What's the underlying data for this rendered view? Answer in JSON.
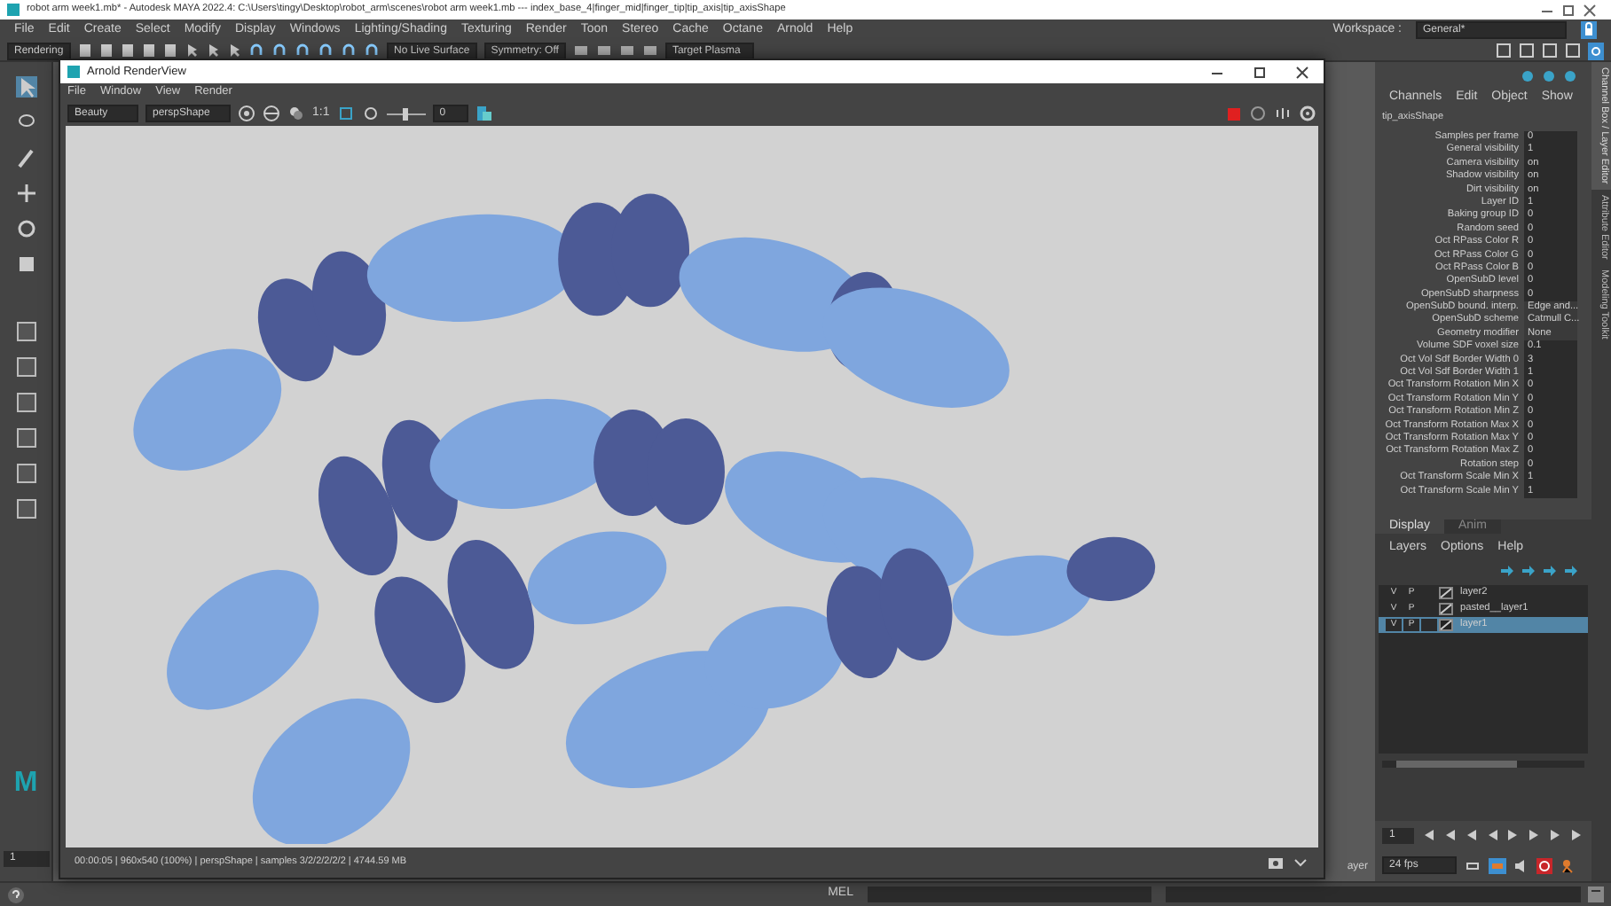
{
  "app_window": {
    "logo": "M",
    "title": "robot arm week1.mb* - Autodesk MAYA 2022.4: C:\\Users\\tingy\\Desktop\\robot_arm\\scenes\\robot arm week1.mb  ---  index_base_4|finger_mid|finger_tip|tip_axis|tip_axisShape"
  },
  "menu_bar": [
    "File",
    "Edit",
    "Create",
    "Select",
    "Modify",
    "Display",
    "Windows",
    "Lighting/Shading",
    "Texturing",
    "Render",
    "Toon",
    "Stereo",
    "Cache",
    "Octane",
    "Arnold",
    "Help"
  ],
  "workspace": {
    "label": "Workspace :",
    "value": "General*"
  },
  "status_line": {
    "menu_set": "Rendering",
    "live_surface": "No Live Surface",
    "symmetry": "Symmetry: Off",
    "target": "Target Plasma"
  },
  "render_view": {
    "title": "Arnold RenderView",
    "menus": [
      "File",
      "Window",
      "View",
      "Render"
    ],
    "aov": "Beauty",
    "camera": "perspShape",
    "ratio": "1:1",
    "exposure": "0",
    "exposure_slider": {
      "level": 0.5
    },
    "status": "00:00:05 | 960x540 (100%) | perspShape  | samples 3/2/2/2/2/2 | 4744.59 MB"
  },
  "channel_box": {
    "menus": [
      "Channels",
      "Edit",
      "Object",
      "Show"
    ],
    "node": "tip_axisShape",
    "attributes": [
      {
        "name": "Samples per frame",
        "value": "0"
      },
      {
        "name": "General visibility",
        "value": "1"
      },
      {
        "name": "Camera visibility",
        "value": "on"
      },
      {
        "name": "Shadow visibility",
        "value": "on"
      },
      {
        "name": "Dirt visibility",
        "value": "on"
      },
      {
        "name": "Layer ID",
        "value": "1"
      },
      {
        "name": "Baking group ID",
        "value": "0"
      },
      {
        "name": "Random seed",
        "value": "0"
      },
      {
        "name": "Oct RPass Color R",
        "value": "0"
      },
      {
        "name": "Oct RPass Color G",
        "value": "0"
      },
      {
        "name": "Oct RPass Color B",
        "value": "0"
      },
      {
        "name": "OpenSubD level",
        "value": "0"
      },
      {
        "name": "OpenSubD sharpness",
        "value": "0"
      },
      {
        "name": "OpenSubD bound. interp.",
        "value": "Edge and..."
      },
      {
        "name": "OpenSubD scheme",
        "value": "Catmull C..."
      },
      {
        "name": "Geometry modifier",
        "value": "None"
      },
      {
        "name": "Volume SDF voxel size",
        "value": "0.1"
      },
      {
        "name": "Oct Vol Sdf Border Width 0",
        "value": "3"
      },
      {
        "name": "Oct Vol Sdf Border Width 1",
        "value": "1"
      },
      {
        "name": "Oct Transform Rotation Min X",
        "value": "0"
      },
      {
        "name": "Oct Transform Rotation Min Y",
        "value": "0"
      },
      {
        "name": "Oct Transform Rotation Min Z",
        "value": "0"
      },
      {
        "name": "Oct Transform Rotation Max X",
        "value": "0"
      },
      {
        "name": "Oct Transform Rotation Max Y",
        "value": "0"
      },
      {
        "name": "Oct Transform Rotation Max Z",
        "value": "0"
      },
      {
        "name": "Rotation step",
        "value": "0"
      },
      {
        "name": "Oct Transform Scale Min X",
        "value": "1"
      },
      {
        "name": "Oct Transform Scale Min Y",
        "value": "1"
      }
    ]
  },
  "side_tabs": [
    {
      "label": "Channel Box / Layer Editor",
      "selected": true
    },
    {
      "label": "Attribute Editor",
      "selected": false
    },
    {
      "label": "Modeling Toolkit",
      "selected": false
    }
  ],
  "layer_editor": {
    "tabs": [
      {
        "label": "Display",
        "selected": true
      },
      {
        "label": "Anim",
        "selected": false
      }
    ],
    "menus": [
      "Layers",
      "Options",
      "Help"
    ],
    "layers": [
      {
        "visible": "V",
        "playback": "P",
        "name": "layer2",
        "selected": false
      },
      {
        "visible": "V",
        "playback": "P",
        "name": "pasted__layer1",
        "selected": false
      },
      {
        "visible": "V",
        "playback": "P",
        "name": "layer1",
        "selected": true
      }
    ]
  },
  "timeline": {
    "start_frame": "1",
    "current_frame": "1",
    "fps": "24 fps",
    "layer_label": "ayer"
  },
  "command_line": {
    "language": "MEL"
  }
}
